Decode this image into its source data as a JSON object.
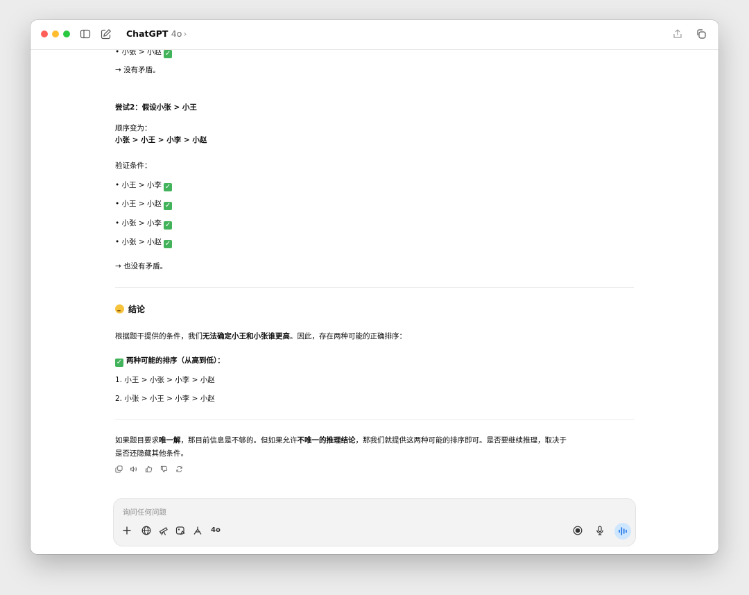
{
  "window": {
    "app_name": "ChatGPT",
    "model": "4o",
    "chevron": "›",
    "icons": [
      "sidebar-toggle-icon",
      "new-chat-icon",
      "share-icon",
      "temporary-chat-icon"
    ]
  },
  "conversation": {
    "top_item": "• 小张 > 小赵",
    "no_conflict_1": "→ 没有矛盾。",
    "attempt2_title": "尝试2：假设小张 > 小王",
    "order_label": "顺序变为：",
    "order_value": "小张 > 小王 > 小李 > 小赵",
    "verify_label": "验证条件：",
    "checks": [
      "• 小王 > 小李",
      "• 小王 > 小赵",
      "• 小张 > 小李",
      "• 小张 > 小赵"
    ],
    "no_conflict_2": "→ 也没有矛盾。",
    "conclusion_title": "结论",
    "conclusion_text": {
      "part1": "根据题干提供的条件，我们",
      "bold": "无法确定小王和小张谁更高",
      "part2": "。因此，存在两种可能的正确排序："
    },
    "possible_title": "两种可能的排序（从高到低）：",
    "options": [
      "1.  小王 > 小张 > 小李 > 小赵",
      "2.  小张 > 小王 > 小李 > 小赵"
    ],
    "final_text": {
      "part1": "如果题目要求",
      "bold1": "唯一解",
      "part2": "，那目前信息是不够的。但如果允许",
      "bold2": "不唯一的推理结论",
      "part3": "，那我们就提供这两种可能的排序即可。是否要继续推理，取决于",
      "line2": "是否还隐藏其他条件。"
    },
    "message_actions": [
      "copy-icon",
      "read-aloud-icon",
      "thumbs-up-icon",
      "thumbs-down-icon",
      "regenerate-icon"
    ]
  },
  "composer": {
    "placeholder": "询问任何问题",
    "model_label": "4o",
    "tools": [
      "plus-icon",
      "globe-icon",
      "telescope-icon",
      "image-icon",
      "canvas-icon"
    ],
    "right_tools": [
      "record-icon",
      "microphone-icon",
      "voice-mode-icon"
    ]
  },
  "colors": {
    "check_green": "#42b35a",
    "voice_button": "#cfe6ff"
  }
}
